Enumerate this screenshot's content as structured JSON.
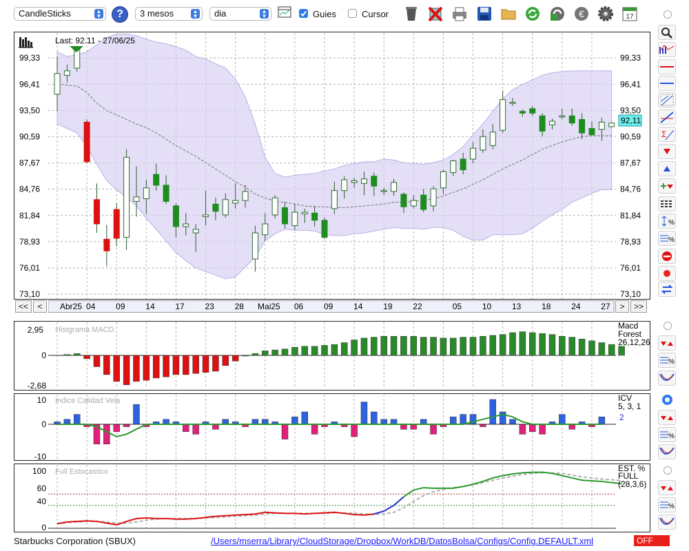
{
  "toolbar": {
    "chart_type": "CandleSticks",
    "help": "?",
    "range": "3 mesos",
    "interval": "dia",
    "guides_label": "Guies",
    "guides_checked": true,
    "cursor_label": "Cursor",
    "cursor_checked": false,
    "icons": [
      "grid-icon",
      "trash-icon",
      "delete-icon",
      "printer-icon",
      "save-icon",
      "folder-icon",
      "refresh-icon",
      "export-icon",
      "euro-icon",
      "gear-icon",
      "calendar-icon"
    ]
  },
  "main_chart": {
    "last_label": "Last: 92.11 - 27/06/25",
    "current_price": "92,11",
    "ymin": 73.1,
    "ymax": 102.25,
    "y_ticks": [
      "99,33",
      "96,41",
      "93,50",
      "90,59",
      "87,67",
      "84,76",
      "81,84",
      "78,93",
      "76,01",
      "73,10"
    ],
    "y_values": [
      99.33,
      96.41,
      93.5,
      90.59,
      87.67,
      84.76,
      81.84,
      78.93,
      76.01,
      73.1
    ],
    "x_labels": [
      {
        "i": 0,
        "t": "Abr25"
      },
      {
        "i": 2,
        "t": "04"
      },
      {
        "i": 5,
        "t": "09"
      },
      {
        "i": 8,
        "t": "14"
      },
      {
        "i": 11,
        "t": "17"
      },
      {
        "i": 14,
        "t": "23"
      },
      {
        "i": 17,
        "t": "28"
      },
      {
        "i": 20,
        "t": "Mai25"
      },
      {
        "i": 23,
        "t": "06"
      },
      {
        "i": 26,
        "t": "09"
      },
      {
        "i": 29,
        "t": "14"
      },
      {
        "i": 32,
        "t": "19"
      },
      {
        "i": 35,
        "t": "22"
      },
      {
        "i": 39,
        "t": "05"
      },
      {
        "i": 42,
        "t": "10"
      },
      {
        "i": 45,
        "t": "13"
      },
      {
        "i": 48,
        "t": "18"
      },
      {
        "i": 51,
        "t": "24"
      },
      {
        "i": 54,
        "t": "27"
      }
    ],
    "colors": {
      "up": "#1e8c1e",
      "down": "#dd1111",
      "band": "#d8d2f4"
    }
  },
  "nav": {
    "first": "<<",
    "prev": "<",
    "next": ">",
    "last": ">>"
  },
  "chart_data": [
    {
      "type": "candlestick",
      "title": "",
      "ylim": [
        73.1,
        102.25
      ],
      "candles": [
        {
          "o": 95.3,
          "h": 99.5,
          "l": 93.4,
          "c": 97.6
        },
        {
          "o": 97.4,
          "h": 98.6,
          "l": 96.6,
          "c": 97.9
        },
        {
          "o": 98.2,
          "h": 100.6,
          "l": 97.8,
          "c": 100.5
        },
        {
          "o": 92.2,
          "h": 92.5,
          "l": 87.6,
          "c": 87.8
        },
        {
          "o": 83.6,
          "h": 85.4,
          "l": 79.9,
          "c": 80.9
        },
        {
          "o": 79.2,
          "h": 80.8,
          "l": 76.2,
          "c": 77.9
        },
        {
          "o": 82.5,
          "h": 83.2,
          "l": 78.4,
          "c": 79.3
        },
        {
          "o": 79.4,
          "h": 89.2,
          "l": 78.0,
          "c": 88.3
        },
        {
          "o": 83.4,
          "h": 87.3,
          "l": 81.7,
          "c": 83.9
        },
        {
          "o": 83.7,
          "h": 85.8,
          "l": 82.0,
          "c": 84.9
        },
        {
          "o": 86.4,
          "h": 87.6,
          "l": 84.6,
          "c": 85.2
        },
        {
          "o": 85.2,
          "h": 86.3,
          "l": 83.1,
          "c": 83.4
        },
        {
          "o": 82.9,
          "h": 83.2,
          "l": 79.4,
          "c": 80.6
        },
        {
          "o": 80.6,
          "h": 82.1,
          "l": 79.6,
          "c": 80.9
        },
        {
          "o": 79.9,
          "h": 80.9,
          "l": 77.8,
          "c": 80.3
        },
        {
          "o": 81.7,
          "h": 84.6,
          "l": 80.7,
          "c": 81.9
        },
        {
          "o": 83.1,
          "h": 83.8,
          "l": 81.3,
          "c": 82.3
        },
        {
          "o": 81.9,
          "h": 84.3,
          "l": 81.6,
          "c": 83.6
        },
        {
          "o": 83.2,
          "h": 85.4,
          "l": 82.6,
          "c": 83.5
        },
        {
          "o": 83.5,
          "h": 85.2,
          "l": 82.7,
          "c": 84.5
        },
        {
          "o": 77.0,
          "h": 80.7,
          "l": 75.6,
          "c": 79.9
        },
        {
          "o": 79.7,
          "h": 82.1,
          "l": 79.0,
          "c": 80.9
        },
        {
          "o": 81.9,
          "h": 84.1,
          "l": 81.5,
          "c": 83.8
        },
        {
          "o": 82.7,
          "h": 83.3,
          "l": 80.4,
          "c": 80.9
        },
        {
          "o": 80.7,
          "h": 83.1,
          "l": 80.2,
          "c": 82.2
        },
        {
          "o": 82.0,
          "h": 82.6,
          "l": 81.0,
          "c": 82.2
        },
        {
          "o": 82.1,
          "h": 82.9,
          "l": 80.6,
          "c": 81.3
        },
        {
          "o": 81.3,
          "h": 81.6,
          "l": 79.2,
          "c": 79.4
        },
        {
          "o": 82.6,
          "h": 85.6,
          "l": 82.0,
          "c": 84.6
        },
        {
          "o": 84.6,
          "h": 86.2,
          "l": 83.7,
          "c": 85.8
        },
        {
          "o": 85.5,
          "h": 86.0,
          "l": 84.9,
          "c": 85.7
        },
        {
          "o": 85.4,
          "h": 86.7,
          "l": 84.1,
          "c": 85.9
        },
        {
          "o": 86.2,
          "h": 86.6,
          "l": 84.0,
          "c": 85.1
        },
        {
          "o": 84.5,
          "h": 84.9,
          "l": 84.1,
          "c": 84.6
        },
        {
          "o": 84.5,
          "h": 85.9,
          "l": 84.0,
          "c": 85.5
        },
        {
          "o": 84.2,
          "h": 84.4,
          "l": 82.1,
          "c": 82.8
        },
        {
          "o": 82.9,
          "h": 84.1,
          "l": 82.6,
          "c": 83.5
        },
        {
          "o": 84.1,
          "h": 84.8,
          "l": 82.2,
          "c": 82.5
        },
        {
          "o": 82.9,
          "h": 85.1,
          "l": 82.3,
          "c": 84.8
        },
        {
          "o": 84.9,
          "h": 86.9,
          "l": 84.2,
          "c": 86.7
        },
        {
          "o": 86.6,
          "h": 88.0,
          "l": 86.2,
          "c": 87.9
        },
        {
          "o": 88.1,
          "h": 88.8,
          "l": 86.4,
          "c": 86.9
        },
        {
          "o": 88.1,
          "h": 90.0,
          "l": 87.6,
          "c": 89.3
        },
        {
          "o": 89.1,
          "h": 91.4,
          "l": 88.8,
          "c": 90.6
        },
        {
          "o": 89.6,
          "h": 92.0,
          "l": 89.2,
          "c": 91.1
        },
        {
          "o": 91.3,
          "h": 95.7,
          "l": 91.0,
          "c": 94.7
        },
        {
          "o": 94.4,
          "h": 94.9,
          "l": 94.0,
          "c": 94.4
        },
        {
          "o": 93.4,
          "h": 93.6,
          "l": 92.8,
          "c": 93.2
        },
        {
          "o": 93.7,
          "h": 94.0,
          "l": 92.9,
          "c": 93.2
        },
        {
          "o": 92.9,
          "h": 93.2,
          "l": 90.6,
          "c": 91.2
        },
        {
          "o": 91.9,
          "h": 92.6,
          "l": 91.4,
          "c": 92.3
        },
        {
          "o": 92.9,
          "h": 93.7,
          "l": 92.5,
          "c": 92.9
        },
        {
          "o": 92.9,
          "h": 93.7,
          "l": 91.8,
          "c": 92.1
        },
        {
          "o": 92.5,
          "h": 93.2,
          "l": 90.3,
          "c": 91.0
        },
        {
          "o": 91.5,
          "h": 92.3,
          "l": 90.7,
          "c": 90.8
        },
        {
          "o": 91.4,
          "h": 92.7,
          "l": 90.1,
          "c": 92.2
        },
        {
          "o": 91.7,
          "h": 92.2,
          "l": 91.6,
          "c": 92.1
        }
      ],
      "bands": {
        "upper": [
          100,
          99.5,
          99.7,
          100,
          100.8,
          101.6,
          102,
          102,
          101.8,
          101.4,
          101.1,
          100.9,
          100.6,
          100.2,
          99.5,
          99.2,
          98.7,
          98.2,
          97,
          95,
          92,
          88.3,
          86.5,
          86.1,
          86.3,
          86.4,
          86.5,
          86.8,
          87,
          87.4,
          87.6,
          87.8,
          87.8,
          88.1,
          88,
          87.7,
          87.6,
          87.5,
          87.7,
          88,
          88.6,
          89.5,
          90.8,
          92,
          93.4,
          94.8,
          95.8,
          96.4,
          96.9,
          97.4,
          97.7,
          97.8,
          97.9,
          97.9,
          97.9,
          97.9,
          97.9
        ],
        "middle": [
          96.5,
          96.3,
          96.2,
          95.5,
          94.3,
          93.5,
          93,
          92.5,
          92,
          91.6,
          91,
          90.3,
          89.6,
          89,
          88.4,
          87.7,
          87,
          86.3,
          85.6,
          85,
          84.2,
          83.8,
          83.4,
          83.3,
          83.1,
          82.9,
          82.8,
          82.8,
          82.7,
          82.7,
          82.8,
          82.9,
          83,
          83.1,
          83.3,
          83.3,
          83.4,
          83.5,
          83.7,
          84,
          84.4,
          84.8,
          85.3,
          85.8,
          86.4,
          87,
          87.5,
          88,
          88.6,
          89.2,
          89.6,
          90,
          90.3,
          90.6,
          90.7,
          90.7,
          90.7
        ],
        "lower": [
          92,
          91.5,
          91,
          89.5,
          87.5,
          85.7,
          84.7,
          83.8,
          82.9,
          81.5,
          80.3,
          79,
          77.7,
          76.8,
          76,
          75.6,
          75.2,
          74.8,
          75,
          76.1,
          77.2,
          79,
          79.8,
          80.3,
          80.2,
          80.2,
          80.1,
          79.7,
          79.6,
          79.6,
          79.8,
          79.9,
          80.1,
          80.3,
          80.5,
          80.4,
          80.4,
          80.3,
          80.5,
          80.5,
          80.2,
          79.5,
          79.1,
          79.1,
          79.7,
          79.7,
          79.7,
          79.8,
          80.4,
          81.2,
          81.9,
          82.5,
          83.3,
          83.8,
          84.3,
          84.7,
          84.7
        ]
      }
    },
    {
      "type": "bar",
      "title": "Histgrama MACD",
      "legend": [
        "Macd",
        "Forest",
        "26,12,26"
      ],
      "y_ticks": [
        "2,95",
        "0",
        "-2,68"
      ],
      "ylim": [
        -2.68,
        2.95
      ],
      "values": [
        0.1,
        0.2,
        -0.3,
        -1,
        -1.7,
        -2.3,
        -2.6,
        -2.3,
        -2.2,
        -2,
        -1.9,
        -1.7,
        -1.7,
        -1.6,
        -1.5,
        -1.4,
        -0.9,
        -0.5,
        0,
        0.2,
        0.5,
        0.6,
        0.7,
        0.9,
        1,
        1,
        1.1,
        1.2,
        1.4,
        1.7,
        1.9,
        2,
        2.1,
        2.1,
        2.1,
        2.1,
        2,
        2,
        1.9,
        1.9,
        2,
        2,
        2.1,
        2.2,
        2.3,
        2.5,
        2.6,
        2.5,
        2.4,
        2.3,
        2.1,
        2,
        1.8,
        1.6,
        1.4,
        1.2,
        1
      ]
    },
    {
      "type": "bar",
      "title": "Indice Calidad Vela",
      "legend": [
        "ICV",
        "5, 3, 1",
        "2"
      ],
      "y_ticks": [
        "10",
        "0",
        "-10"
      ],
      "ylim": [
        -11,
        11
      ],
      "values": [
        1,
        2,
        4,
        -1,
        -8,
        -8,
        -3,
        -1,
        8,
        -1,
        1,
        2,
        1,
        -3,
        -4,
        1,
        -2,
        2,
        1,
        -1,
        2,
        2,
        1,
        -6,
        3,
        5,
        -4,
        -1,
        1,
        -1,
        -5,
        9,
        5,
        2,
        2,
        -2,
        -2,
        2,
        -4,
        -1,
        3,
        4,
        4,
        -1,
        10,
        5,
        2,
        -4,
        -3,
        -4,
        1,
        4,
        -2,
        1,
        -1,
        3
      ],
      "line": [
        0,
        0,
        0,
        0,
        -1,
        -3,
        -5,
        -4,
        -2,
        0,
        0,
        0,
        0,
        0,
        0,
        0,
        0,
        0,
        0,
        0,
        0,
        0,
        0,
        0,
        0,
        0,
        0,
        0,
        0,
        0,
        0,
        0,
        0,
        0,
        0,
        0,
        0,
        0,
        0,
        0,
        0,
        0,
        1,
        2,
        3,
        4,
        3,
        1,
        0,
        0,
        0,
        0,
        0,
        0,
        0,
        0
      ]
    },
    {
      "type": "line",
      "title": "Full Estocastico",
      "legend": [
        "EST. %",
        "FULL",
        "(28,3,6)"
      ],
      "y_ticks": [
        "100",
        "60",
        "40",
        "0"
      ],
      "ylim": [
        0,
        100
      ],
      "series": [
        {
          "values": [
            8,
            11,
            12,
            13,
            12,
            9,
            6,
            12,
            17,
            18,
            17,
            17,
            16,
            16,
            17,
            19,
            21,
            22,
            23,
            24,
            25,
            28,
            27,
            26,
            26,
            25,
            26,
            27,
            28,
            26,
            24,
            23,
            25,
            30,
            40,
            55,
            67,
            71,
            70,
            70,
            70,
            73,
            77,
            82,
            88,
            92,
            95,
            97,
            98,
            98,
            96,
            92,
            88,
            84,
            83,
            82,
            80,
            78
          ]
        },
        {
          "values": [
            8,
            10,
            11,
            12,
            12,
            11,
            9,
            9,
            11,
            14,
            16,
            17,
            17,
            17,
            17,
            18,
            19,
            20,
            21,
            22,
            23,
            25,
            26,
            26,
            26,
            26,
            26,
            26,
            27,
            27,
            26,
            25,
            24,
            25,
            28,
            36,
            47,
            57,
            64,
            68,
            71,
            73,
            76,
            80,
            84,
            88,
            91,
            94,
            96,
            97,
            97,
            96,
            93,
            90,
            88,
            86,
            85,
            83
          ]
        }
      ]
    }
  ],
  "footer": {
    "company": "Starbucks Corporation (SBUX)",
    "path": "/Users/mserra/Library/CloudStorage/Dropbox/WorkDB/DatosBolsa/Configs/Config.DEFAULT.xml",
    "status": "OFF"
  }
}
